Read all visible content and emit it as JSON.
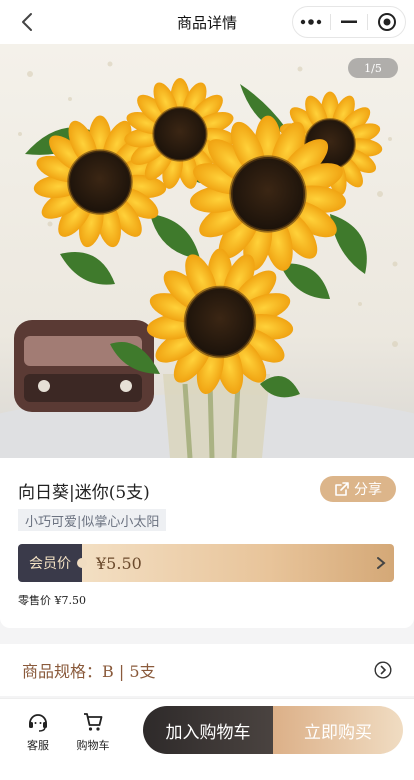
{
  "header": {
    "title": "商品详情",
    "back_icon": "back-arrow-icon",
    "more_icon": "more-dots-icon",
    "minimize_icon": "minimize-icon",
    "close_icon": "target-circle-icon"
  },
  "hero": {
    "pager": "1/5"
  },
  "product": {
    "name": "向日葵|迷你(5支)",
    "share_label": "分享",
    "tag": "小巧可爱|似掌心小太阳",
    "member_label": "会员价",
    "member_price": "¥5.50",
    "retail_label": "零售价",
    "retail_price": "¥7.50"
  },
  "spec": {
    "text": "商品规格：B | 5支"
  },
  "bottom_bar": {
    "service_label": "客服",
    "cart_label": "购物车",
    "add_to_cart": "加入购物车",
    "buy_now": "立即购买"
  },
  "colors": {
    "accent_gold": "#dcb58a",
    "dark": "#3a3a4a",
    "spec_text": "#8a5a3b"
  }
}
